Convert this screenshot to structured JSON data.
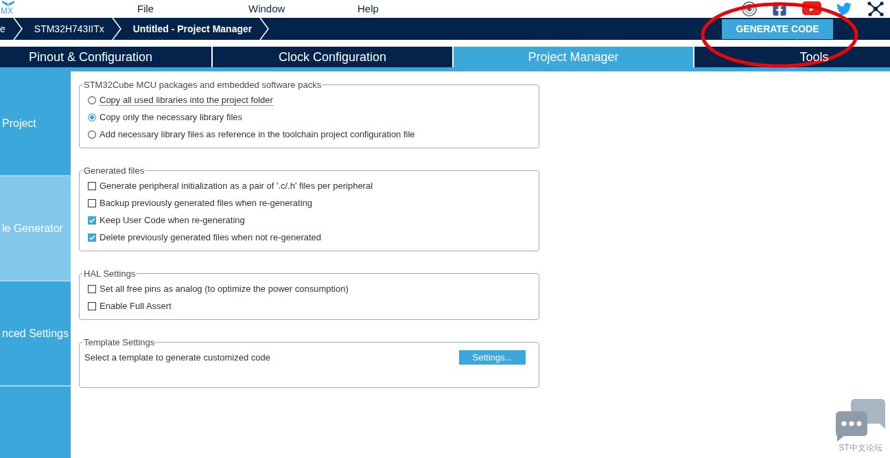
{
  "menu_bar": {
    "logo_text": "MX",
    "items": [
      "File",
      "Window",
      "Help"
    ]
  },
  "breadcrumb": [
    {
      "label": "e",
      "current": false
    },
    {
      "label": "STM32H743IITx",
      "current": false
    },
    {
      "label": "Untitled - Project Manager",
      "current": true
    }
  ],
  "generate_button": "GENERATE CODE",
  "tabs": [
    {
      "label": "Pinout & Configuration",
      "selected": false
    },
    {
      "label": "Clock Configuration",
      "selected": false
    },
    {
      "label": "Project Manager",
      "selected": true
    },
    {
      "label": "Tools",
      "selected": false
    }
  ],
  "sidebar": {
    "items": [
      {
        "label": "Project",
        "selected": false
      },
      {
        "label": "le Generator",
        "selected": true
      },
      {
        "label": "nced Settings",
        "selected": false
      }
    ]
  },
  "sections": [
    {
      "kind": "radio",
      "legend": "STM32Cube MCU packages and embedded software packs",
      "options": [
        {
          "label": "Copy all used libraries into the project folder",
          "selected": false,
          "focused": true
        },
        {
          "label": "Copy only the necessary library files",
          "selected": true,
          "focused": false
        },
        {
          "label": "Add necessary library files as reference in the toolchain project configuration file",
          "selected": false,
          "focused": false
        }
      ]
    },
    {
      "kind": "checkbox",
      "legend": "Generated files",
      "options": [
        {
          "label": "Generate peripheral initialization as a pair of '.c/.h' files per peripheral",
          "checked": false
        },
        {
          "label": "Backup previously generated files when re-generating",
          "checked": false
        },
        {
          "label": "Keep User Code when re-generating",
          "checked": true
        },
        {
          "label": "Delete previously generated files when not re-generated",
          "checked": true
        }
      ]
    },
    {
      "kind": "checkbox",
      "legend": "HAL Settings",
      "options": [
        {
          "label": "Set all free pins as analog (to optimize the power consumption)",
          "checked": false
        },
        {
          "label": "Enable Full Assert",
          "checked": false
        }
      ]
    },
    {
      "kind": "template",
      "legend": "Template Settings",
      "text": "Select a template to generate customized code",
      "button": "Settings..."
    }
  ],
  "chat_widget": {
    "label": "ST中文论坛"
  }
}
